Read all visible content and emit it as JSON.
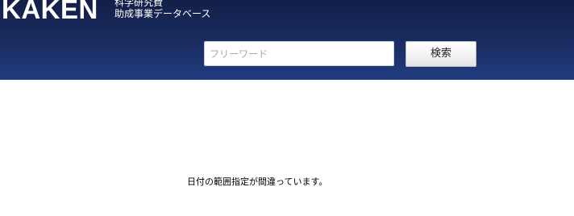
{
  "header": {
    "logo_text": "KAKEN",
    "logo_subtitle_line1": "科学研究費",
    "logo_subtitle_line2": "助成事業データベース"
  },
  "search": {
    "placeholder": "フリーワード",
    "value": "",
    "button_label": "検索"
  },
  "main": {
    "error_message": "日付の範囲指定が間違っています。"
  },
  "colors": {
    "header_top": "#121f48",
    "header_bottom": "#203c80"
  }
}
